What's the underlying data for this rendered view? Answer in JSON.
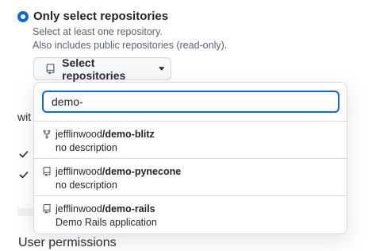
{
  "access": {
    "option_label": "Only select repositories",
    "help_line1": "Select at least one repository.",
    "help_line2": "Also includes public repositories (read-only).",
    "select_button_label": "Select repositories"
  },
  "search": {
    "value": "demo-"
  },
  "repositories": [
    {
      "owner": "jefflinwood",
      "name": "/demo-blitz",
      "description": "no description",
      "icon": "repo-forked-icon"
    },
    {
      "owner": "jefflinwood",
      "name": "/demo-pynecone",
      "description": "no description",
      "icon": "repo-icon"
    },
    {
      "owner": "jefflinwood",
      "name": "/demo-rails",
      "description": "Demo Rails application",
      "icon": "repo-icon"
    }
  ],
  "background": {
    "partial_heading": "wit",
    "section_title": "User permissions"
  },
  "colors": {
    "accent": "#0969da",
    "muted_text": "#59636e",
    "border": "#d1d9e0"
  }
}
